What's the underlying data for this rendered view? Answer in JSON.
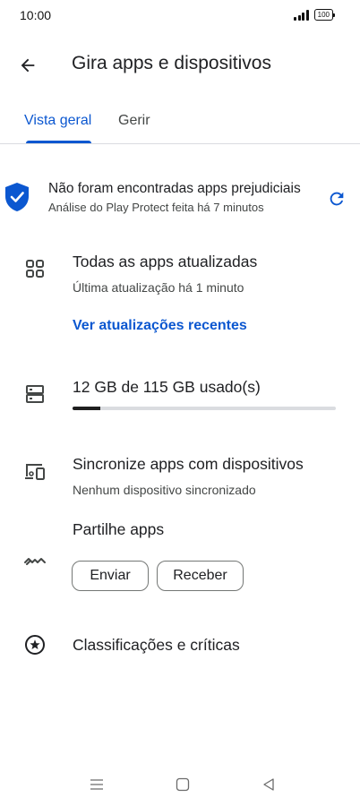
{
  "status_bar": {
    "time": "10:00",
    "battery": "100"
  },
  "header": {
    "title": "Gira apps e dispositivos"
  },
  "tabs": [
    {
      "label": "Vista geral",
      "selected": true
    },
    {
      "label": "Gerir",
      "selected": false
    }
  ],
  "protect": {
    "title": "Não foram encontradas apps prejudiciais",
    "subtitle": "Análise do Play Protect feita há 7 minutos",
    "icon": "shield-check-icon"
  },
  "updates": {
    "title": "Todas as apps atualizadas",
    "subtitle": "Última atualização há 1 minuto",
    "link": "Ver atualizações recentes",
    "icon": "apps-grid-icon"
  },
  "storage": {
    "title": "12 GB de 115 GB usado(s)",
    "used_gb": 12,
    "total_gb": 115,
    "icon": "storage-icon"
  },
  "sync": {
    "title": "Sincronize apps com dispositivos",
    "subtitle": "Nenhum dispositivo sincronizado",
    "icon": "devices-icon"
  },
  "share": {
    "title": "Partilhe apps",
    "send_label": "Enviar",
    "receive_label": "Receber",
    "icon": "nearby-share-icon"
  },
  "ratings": {
    "title": "Classificações e críticas",
    "icon": "star-circle-icon"
  },
  "colors": {
    "accent": "#0b57d0",
    "text": "#202124",
    "secondary": "#444746",
    "divider": "#dadce0"
  }
}
